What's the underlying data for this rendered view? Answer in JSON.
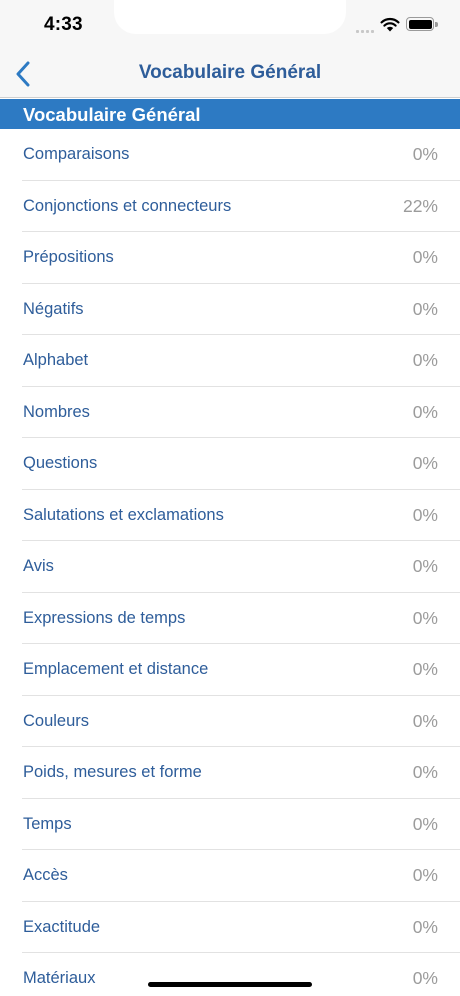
{
  "status_bar": {
    "time": "4:33"
  },
  "nav": {
    "title": "Vocabulaire Général",
    "back_icon": "chevron-left-icon"
  },
  "section": {
    "title": "Vocabulaire Général"
  },
  "items": [
    {
      "label": "Comparaisons",
      "value": "0%"
    },
    {
      "label": "Conjonctions et connecteurs",
      "value": "22%"
    },
    {
      "label": "Prépositions",
      "value": "0%"
    },
    {
      "label": "Négatifs",
      "value": "0%"
    },
    {
      "label": "Alphabet",
      "value": "0%"
    },
    {
      "label": "Nombres",
      "value": "0%"
    },
    {
      "label": "Questions",
      "value": "0%"
    },
    {
      "label": "Salutations et exclamations",
      "value": "0%"
    },
    {
      "label": "Avis",
      "value": "0%"
    },
    {
      "label": "Expressions de temps",
      "value": "0%"
    },
    {
      "label": "Emplacement et distance",
      "value": "0%"
    },
    {
      "label": "Couleurs",
      "value": "0%"
    },
    {
      "label": "Poids, mesures et forme",
      "value": "0%"
    },
    {
      "label": "Temps",
      "value": "0%"
    },
    {
      "label": "Accès",
      "value": "0%"
    },
    {
      "label": "Exactitude",
      "value": "0%"
    },
    {
      "label": "Matériaux",
      "value": "0%"
    }
  ],
  "colors": {
    "accent": "#2d7ac3",
    "title_text": "#2e5d9a",
    "value_text": "#9b9b9b"
  }
}
